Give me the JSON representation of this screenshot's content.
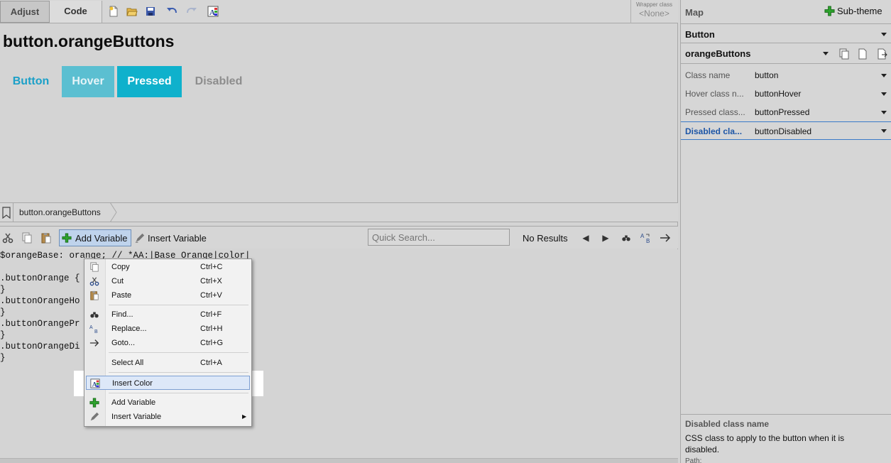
{
  "tabs": {
    "adjust": "Adjust",
    "code": "Code"
  },
  "wrapper": {
    "label": "Wrapper class",
    "value": "<None>"
  },
  "preview": {
    "title": "button.orangeButtons",
    "buttons": {
      "normal": "Button",
      "hover": "Hover",
      "pressed": "Pressed",
      "disabled": "Disabled"
    },
    "colors": {
      "normal_text": "#1ba0c8",
      "hover_bg": "#5bbfd1",
      "pressed_bg": "#0fb1cc",
      "disabled_text": "#8d8d8d"
    }
  },
  "breadcrumb": {
    "item": "button.orangeButtons"
  },
  "editor_toolbar": {
    "add_variable": "Add Variable",
    "insert_variable": "Insert Variable",
    "search_placeholder": "Quick Search...",
    "results": "No Results"
  },
  "code_lines": {
    "l0": "$orangeBase: orange; // *AA:|Base Orange|color|",
    "l1": ".buttonOrange {",
    "l2": "}",
    "l3": ".buttonOrangeHo",
    "l4": "}",
    "l5": ".buttonOrangePr",
    "l6": "}",
    "l7": ".buttonOrangeDi",
    "l8": "}"
  },
  "context_menu": {
    "copy": {
      "label": "Copy",
      "shortcut": "Ctrl+C"
    },
    "cut": {
      "label": "Cut",
      "shortcut": "Ctrl+X"
    },
    "paste": {
      "label": "Paste",
      "shortcut": "Ctrl+V"
    },
    "find": {
      "label": "Find...",
      "shortcut": "Ctrl+F"
    },
    "replace": {
      "label": "Replace...",
      "shortcut": "Ctrl+H"
    },
    "goto": {
      "label": "Goto...",
      "shortcut": "Ctrl+G"
    },
    "select_all": {
      "label": "Select All",
      "shortcut": "Ctrl+A"
    },
    "insert_color": {
      "label": "Insert Color"
    },
    "add_variable": {
      "label": "Add Variable"
    },
    "insert_variable": {
      "label": "Insert Variable"
    }
  },
  "map": {
    "title": "Map",
    "subtheme": "Sub-theme",
    "type": "Button",
    "style": "orangeButtons",
    "properties": {
      "class_name": {
        "key": "Class name",
        "value": "button"
      },
      "hover_class": {
        "key": "Hover class n...",
        "value": "buttonHover"
      },
      "pressed_class": {
        "key": "Pressed class...",
        "value": "buttonPressed"
      },
      "disabled_class": {
        "key": "Disabled cla...",
        "value": "buttonDisabled"
      }
    },
    "description": {
      "title": "Disabled class name",
      "text": "CSS class to apply to the button when it is disabled.",
      "path": "Path:"
    }
  },
  "icons": [
    "cut-icon",
    "copy-icon",
    "paste-icon",
    "new-file-icon",
    "open-folder-icon",
    "save-icon",
    "undo-icon",
    "redo-icon",
    "insert-color-icon",
    "bookmark-icon",
    "find-icon",
    "replace-icon",
    "goto-icon",
    "add-icon",
    "pencil-icon"
  ],
  "accent": "#3a7ac8"
}
